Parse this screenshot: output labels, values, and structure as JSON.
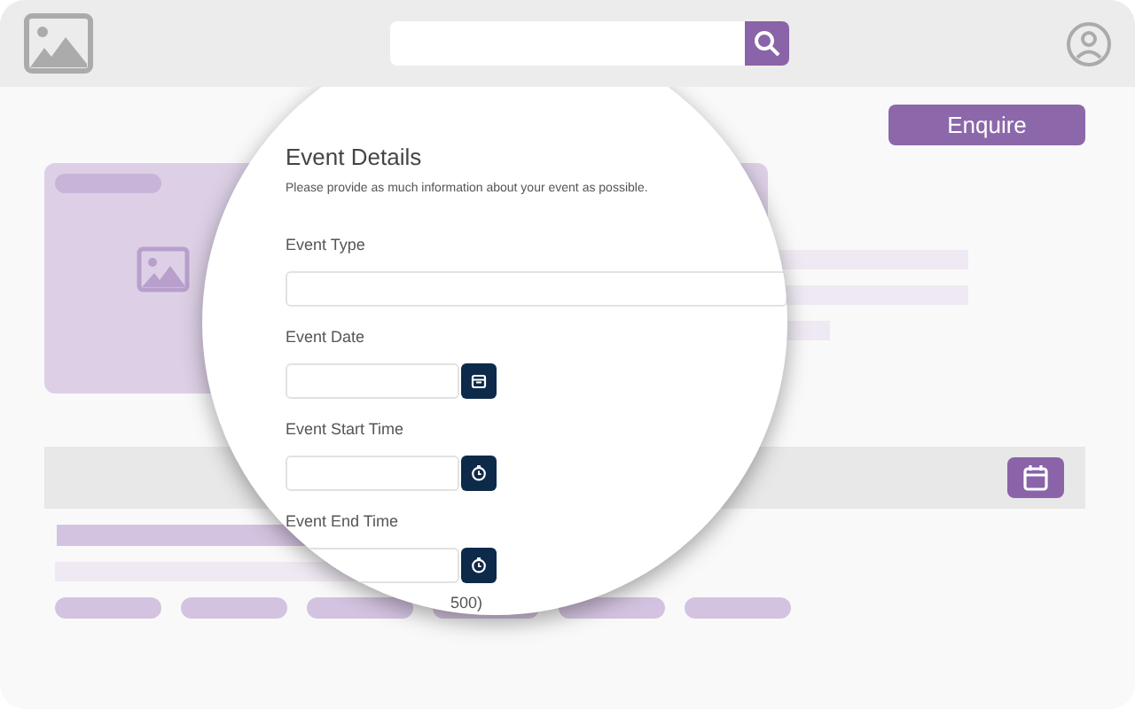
{
  "enquire_button": {
    "label": "Enquire"
  },
  "form": {
    "title": "Event Details",
    "description": "Please provide as much information about your event as possible.",
    "fields": [
      {
        "label": "Event Type",
        "kind": "text"
      },
      {
        "label": "Event Date",
        "kind": "date"
      },
      {
        "label": "Event Start Time",
        "kind": "time"
      },
      {
        "label": "Event End Time",
        "kind": "time"
      }
    ],
    "cut_text": "500)"
  }
}
